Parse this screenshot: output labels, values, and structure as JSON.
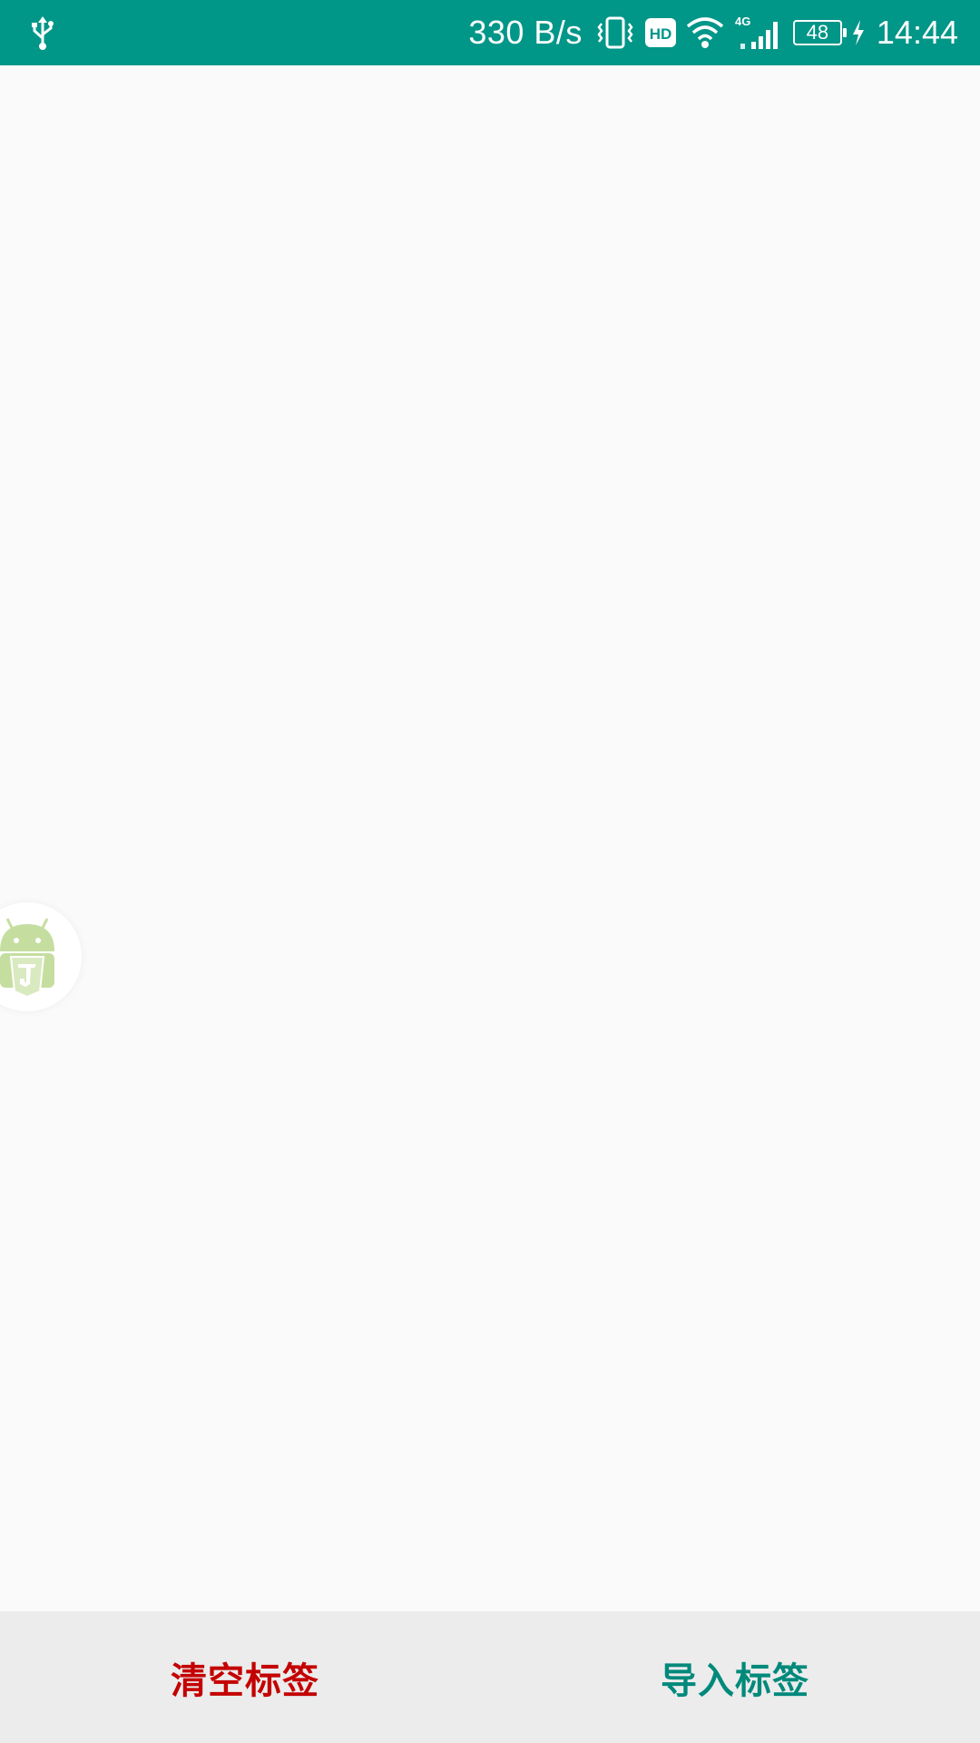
{
  "status_bar": {
    "net_speed": "330 B/s",
    "hd_label": "HD",
    "network_type": "4G",
    "battery_level": "48",
    "time": "14:44",
    "icons": [
      "usb-icon",
      "vibrate-icon",
      "hd-icon",
      "wifi-icon",
      "signal-icon",
      "battery-icon",
      "charging-icon"
    ],
    "background_color": "#009688"
  },
  "floating_bubble": {
    "icon": "android-html5-icon"
  },
  "bottom_bar": {
    "clear_label": "清空标签",
    "import_label": "导入标签",
    "clear_color": "#c40000",
    "import_color": "#00897b"
  }
}
